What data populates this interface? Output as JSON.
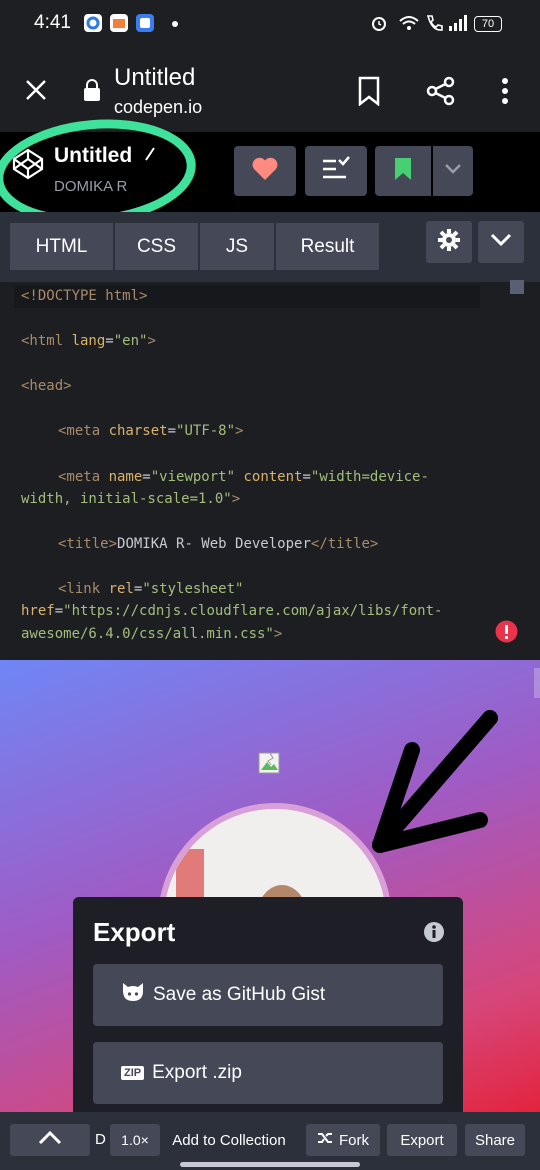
{
  "status": {
    "time": "4:41",
    "battery": "70"
  },
  "browser": {
    "title": "Untitled",
    "url": "codepen.io"
  },
  "pen": {
    "title": "Untitled",
    "author": "DOMIKA R"
  },
  "tabs": [
    "HTML",
    "CSS",
    "JS",
    "Result"
  ],
  "code": {
    "l1": "<!DOCTYPE html>",
    "l2_open": "<html ",
    "l2_attr": "lang",
    "l2_eq": "=",
    "l2_val": "\"en\"",
    "l2_close": ">",
    "l3": "<head>",
    "l4_open": "<meta ",
    "l4_attr": "charset",
    "l4_eq": "=",
    "l4_val": "\"UTF-8\"",
    "l4_close": ">",
    "l5_open": "<meta ",
    "l5_attr1": "name",
    "l5_eq": "=",
    "l5_val1": "\"viewport\"",
    "l5_attr2": " content",
    "l5_val2a": "\"width=device-",
    "l6_val": "width, initial-scale=1.0\"",
    "l6_close": ">",
    "l7_open": "<title>",
    "l7_text": "DOMIKA R- Web Developer",
    "l7_close": "</title>",
    "l8_open": "<link ",
    "l8_attr": "rel",
    "l8_val": "\"stylesheet\"",
    "l9_attr": "href",
    "l9_val": "\"https://cdnjs.cloudflare.com/ajax/libs/font-",
    "l10_val": "awesome/6.4.0/css/all.min.css\"",
    "l10_close": ">"
  },
  "export": {
    "title": "Export",
    "gist": "Save as GitHub Gist",
    "zip_badge": "ZIP",
    "zip": "Export .zip"
  },
  "bottom": {
    "d": "D",
    "zoom": "1.0×",
    "add": "Add to Collection",
    "fork": "Fork",
    "export": "Export",
    "share": "Share"
  },
  "colors": {
    "accent_highlight": "#3ee29a",
    "heart": "#ff8a80",
    "bookmark": "#47cf73",
    "error": "#e9334a"
  }
}
